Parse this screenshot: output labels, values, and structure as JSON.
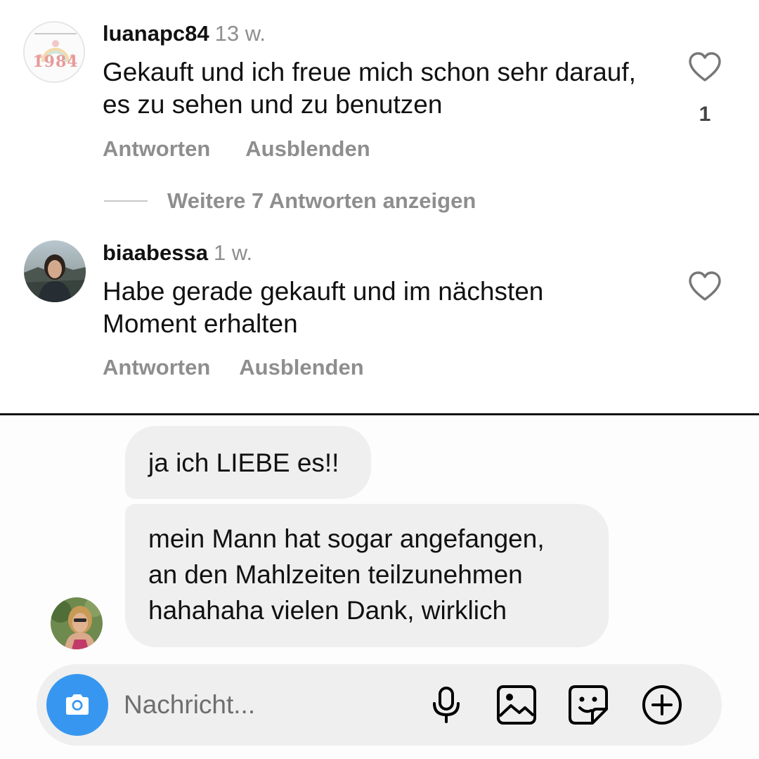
{
  "comments": [
    {
      "username": "luanapc84",
      "time": "13 w.",
      "text": "Gekauft und ich freue mich schon sehr darauf, es zu sehen und zu benutzen",
      "reply_label": "Antworten",
      "hide_label": "Ausblenden",
      "like_count": "1",
      "avatar_text": "1984",
      "avatar_icon": "badge-1984-avatar"
    },
    {
      "username": "biaabessa",
      "time": "1 w.",
      "text": "Habe gerade gekauft und im nächsten Moment erhalten",
      "reply_label": "Antworten",
      "hide_label": "Ausblenden",
      "avatar_icon": "photo-avatar"
    }
  ],
  "more_replies": "Weitere 7 Antworten anzeigen",
  "chat": {
    "messages": [
      {
        "text": "ja ich LIEBE es!!"
      },
      {
        "lines": [
          "mein Mann hat sogar angefangen,",
          "an den Mahlzeiten teilzunehmen",
          "hahahaha vielen Dank, wirklich"
        ]
      }
    ],
    "composer": {
      "placeholder": "Nachricht...",
      "icons": [
        "camera-icon",
        "microphone-icon",
        "gallery-icon",
        "sticker-icon",
        "plus-circle-icon"
      ],
      "camera_color": "#3797f0"
    }
  }
}
